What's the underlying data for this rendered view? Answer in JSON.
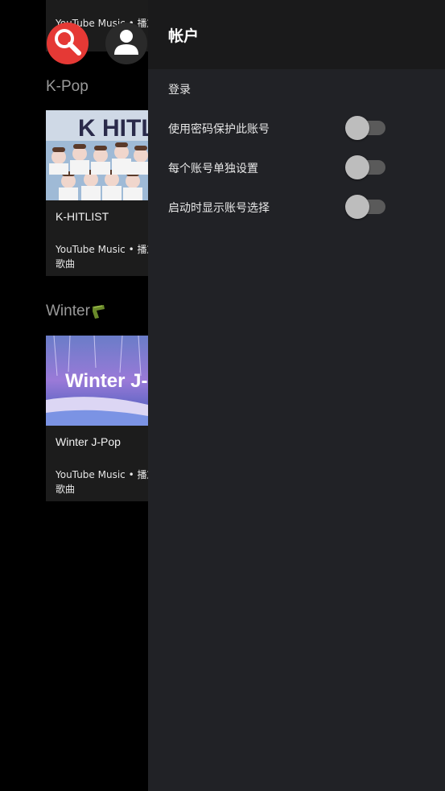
{
  "left": {
    "top_card_sub": "YouTube Music • 播放列",
    "sections": [
      {
        "title": "K-Pop",
        "card_title": "K-HITLIST",
        "card_sub1": "YouTube Music • 播放列",
        "card_sub2": "歌曲",
        "thumb_text": "K HITL"
      },
      {
        "title": "Winter",
        "card_title": "Winter J-Pop",
        "card_sub1": "YouTube Music • 播放列",
        "card_sub2": "歌曲",
        "thumb_text": "Winter J-"
      }
    ]
  },
  "icons": {
    "search": "search-icon",
    "user": "account-icon",
    "scarf": "scarf-emoji"
  },
  "colors": {
    "accent_red": "#e53935",
    "panel_bg": "#212226",
    "header_bg": "#1a1a1b"
  },
  "panel": {
    "title": "帐户",
    "items": [
      {
        "label": "登录"
      },
      {
        "label": "使用密码保护此账号",
        "toggle_on": false
      },
      {
        "label": "每个账号单独设置",
        "toggle_on": false
      },
      {
        "label": "启动时显示账号选择",
        "toggle_on": false
      }
    ]
  }
}
